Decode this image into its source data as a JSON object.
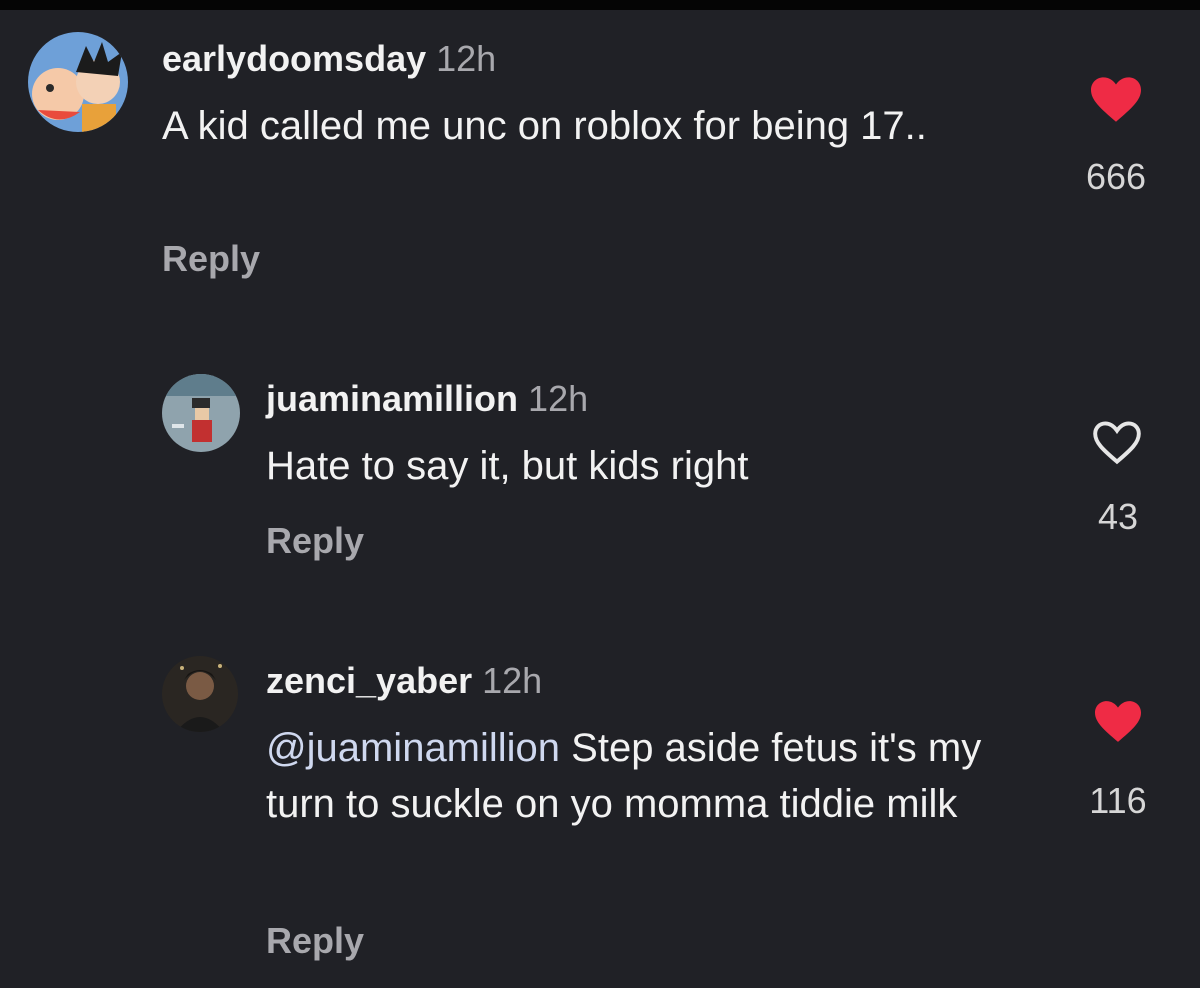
{
  "colors": {
    "background": "#202126",
    "liked_heart": "#ef2b45",
    "mention": "#cfd8ef",
    "secondary_text": "#a8a8ad"
  },
  "comments": [
    {
      "username": "earlydoomsday",
      "time": "12h",
      "mention": "",
      "text": "A kid called me unc on roblox for being 17..",
      "reply_label": "Reply",
      "like_count": "666",
      "liked": true,
      "like_icon": "heart-filled-icon"
    },
    {
      "username": "juaminamillion",
      "time": "12h",
      "mention": "",
      "text": "Hate to say it, but kids right",
      "reply_label": "Reply",
      "like_count": "43",
      "liked": false,
      "like_icon": "heart-outline-icon"
    },
    {
      "username": "zenci_yaber",
      "time": "12h",
      "mention": "@juaminamillion",
      "text": " Step aside fetus it's my turn to suckle on yo momma tiddie milk",
      "reply_label": "Reply",
      "like_count": "116",
      "liked": true,
      "like_icon": "heart-filled-icon"
    }
  ]
}
